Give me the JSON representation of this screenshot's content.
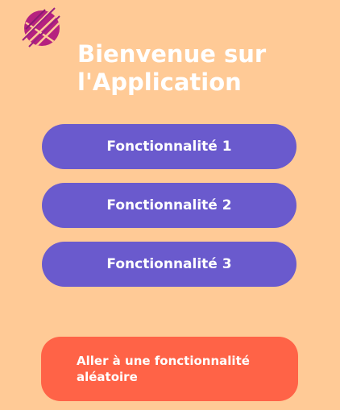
{
  "app": {
    "logo_icon": "app-logo-icon",
    "title": "Bienvenue sur\nl'Application"
  },
  "features": [
    {
      "label": "Fonctionnalité 1"
    },
    {
      "label": "Fonctionnalité 2"
    },
    {
      "label": "Fonctionnalité 3"
    }
  ],
  "random": {
    "label": "Aller à une fonctionnalité aléatoire"
  },
  "colors": {
    "background": "#FFCA96",
    "feature_button": "#6A5ACD",
    "random_button": "#FF6347",
    "text": "#FFFFFF",
    "logo_primary": "#B5217F"
  }
}
